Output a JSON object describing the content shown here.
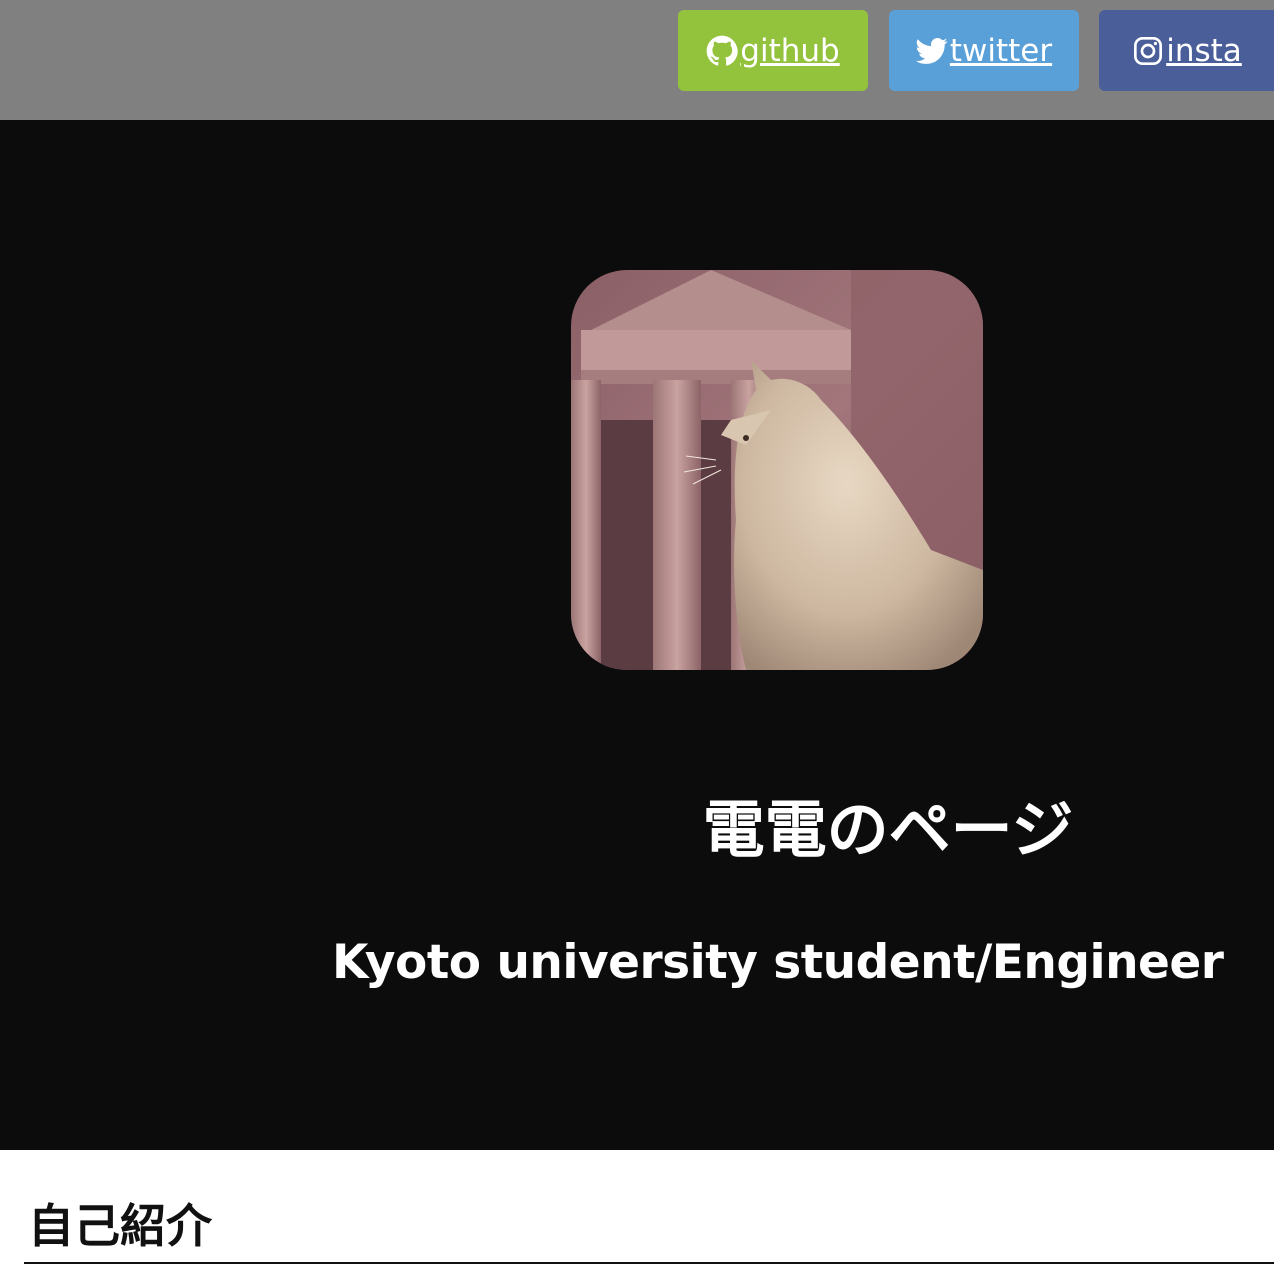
{
  "header": {
    "links": [
      {
        "label": " github",
        "icon": "github-icon",
        "color": "#93c23d"
      },
      {
        "label": " twitter",
        "icon": "twitter-icon",
        "color": "#5aa0d8"
      },
      {
        "label": " insta",
        "icon": "instagram-icon",
        "color": "#4a5f99"
      }
    ],
    "background": "#808080"
  },
  "hero": {
    "background": "#0c0c0c",
    "avatar": {
      "alt": "cat-photo"
    },
    "title": "電電のページ",
    "subtitle": "Kyoto university student/Engineer"
  },
  "content": {
    "section_heading": "自己紹介"
  }
}
